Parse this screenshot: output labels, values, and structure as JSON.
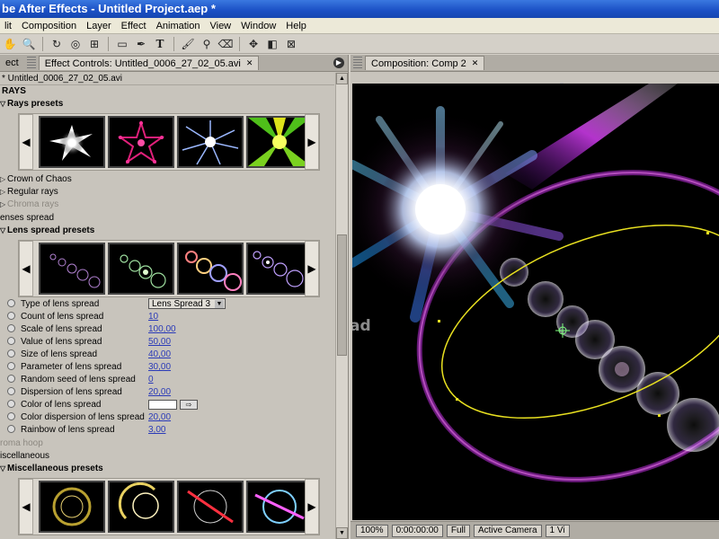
{
  "app": {
    "title": "be After Effects - Untitled Project.aep *"
  },
  "menu": [
    "lit",
    "Composition",
    "Layer",
    "Effect",
    "Animation",
    "View",
    "Window",
    "Help"
  ],
  "toolbar": {
    "icons": [
      "hand-icon",
      "zoom-icon",
      "rotate-icon",
      "orbit-icon",
      "pan-behind-icon",
      "rectangle-mask-icon",
      "pen-icon",
      "text-icon",
      "brush-icon",
      "clone-stamp-icon",
      "eraser-icon",
      "axis-icon",
      "local-axis-icon",
      "world-axis-icon"
    ]
  },
  "left_panel": {
    "tab_prev": "ect",
    "tab_active": "Effect Controls: Untitled_0006_27_02_05.avi",
    "layer_name": "* Untitled_0006_27_02_05.avi",
    "effect_name": "RAYS",
    "rays_presets_label": "Rays presets",
    "rays_items": [
      "Crown of Chaos",
      "Regular rays",
      "Chroma rays"
    ],
    "lens_spread_header": "enses spread",
    "lens_spread_presets_label": "Lens spread presets",
    "params": [
      {
        "label": "Type of lens spread",
        "value": "Lens Spread 3",
        "kind": "dropdown"
      },
      {
        "label": "Count of lens spread",
        "value": "10",
        "kind": "number"
      },
      {
        "label": "Scale of lens spread",
        "value": "100,00",
        "kind": "number"
      },
      {
        "label": "Value of lens spread",
        "value": "50,00",
        "kind": "number"
      },
      {
        "label": "Size of lens spread",
        "value": "40,00",
        "kind": "number"
      },
      {
        "label": "Parameter of lens spread",
        "value": "30,00",
        "kind": "number"
      },
      {
        "label": "Random seed of lens spread",
        "value": "0",
        "kind": "number"
      },
      {
        "label": "Dispersion of lens spread",
        "value": "20,00",
        "kind": "number"
      },
      {
        "label": "Color of lens spread",
        "value": "",
        "kind": "color"
      },
      {
        "label": "Color dispersion of lens spread",
        "value": "20,00",
        "kind": "number"
      },
      {
        "label": "Rainbow of lens spread",
        "value": "3,00",
        "kind": "number"
      }
    ],
    "chroma_hoop": "roma hoop",
    "miscellaneous": "iscellaneous",
    "misc_presets_label": "Miscellaneous presets"
  },
  "right_panel": {
    "tab_label": "Composition: Comp 2",
    "watermark": "ownload",
    "footer": {
      "zoom": "100%",
      "timecode": "0:00:00:00",
      "resolution": "Full",
      "camera": "Active Camera",
      "view": "1 Vi"
    }
  },
  "colors": {
    "title_bar": "#1a4fc4",
    "panel_bg": "#c8c4bc",
    "value_link": "#2b3bb8",
    "motion_path": "#e8e020"
  }
}
